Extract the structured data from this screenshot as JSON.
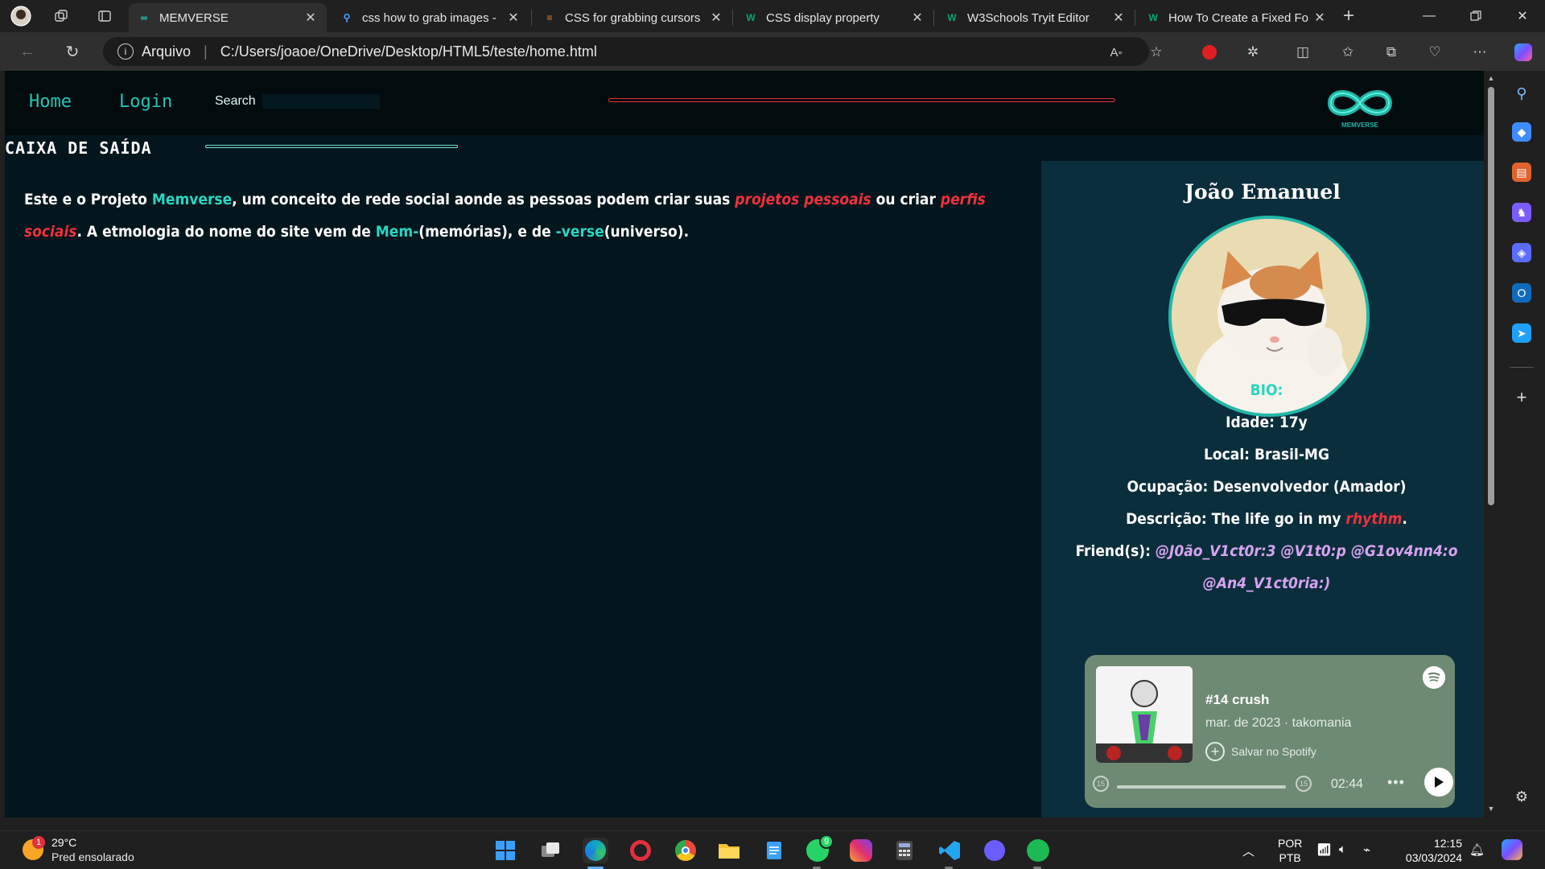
{
  "browser": {
    "tabs": [
      {
        "title": "MEMVERSE",
        "active": true
      },
      {
        "title": "css how to grab images -"
      },
      {
        "title": "CSS for grabbing cursors"
      },
      {
        "title": "CSS display property"
      },
      {
        "title": "W3Schools Tryit Editor"
      },
      {
        "title": "How To Create a Fixed Fo"
      }
    ],
    "address": {
      "scheme_label": "Arquivo",
      "url": "C:/Users/joaoe/OneDrive/Desktop/HTML5/teste/home.html"
    }
  },
  "site": {
    "nav": {
      "home": "Home",
      "login": "Login",
      "search_label": "Search",
      "logo_text": "MEMVERSE"
    },
    "inbox_title": "CAIXA DE SAÍDA",
    "intro": {
      "p1": "Este e o Projeto ",
      "brand": "Memverse",
      "p2": ", um conceito de rede social aonde as pessoas podem criar suas ",
      "link1": "projetos pessoais",
      "p3": " ou criar ",
      "link2": "perfis sociais",
      "p4": ". A etmologia do nome do site vem de ",
      "mem": "Mem-",
      "p5": "(memórias), e de ",
      "verse": "-verse",
      "p6": "(universo)."
    },
    "profile": {
      "name": "João Emanuel",
      "bio_heading": "BIO:",
      "age": "Idade: 17y",
      "location": "Local: Brasil-MG",
      "occupation": "Ocupação: Desenvolvedor (Amador)",
      "description_prefix": "Descrição: The life go in my ",
      "description_highlight": "rhythm",
      "description_suffix": ".",
      "friends_label": "Friend(s): ",
      "friends_line1": "@J0ão_V1ct0r:3 @V1t0:p @G1ov4nn4:o",
      "friends_line2": "@An4_V1ct0ria:)"
    },
    "spotify": {
      "track": "#14 crush",
      "meta": "mar. de 2023 · takomania",
      "save": "Salvar no Spotify",
      "time": "02:44",
      "back_skip": "15",
      "fwd_skip": "15"
    }
  },
  "taskbar": {
    "weather": {
      "temp": "29°C",
      "desc": "Pred ensolarado",
      "badge": "1"
    },
    "whatsapp_badge": "9",
    "lang": {
      "line1": "POR",
      "line2": "PTB"
    },
    "clock": {
      "time": "12:15",
      "date": "03/03/2024"
    }
  },
  "colors": {
    "accent_teal": "#27d6c0",
    "accent_red": "#f0303c",
    "page_bg": "#03161d",
    "panel_bg": "#0b2e3c"
  }
}
